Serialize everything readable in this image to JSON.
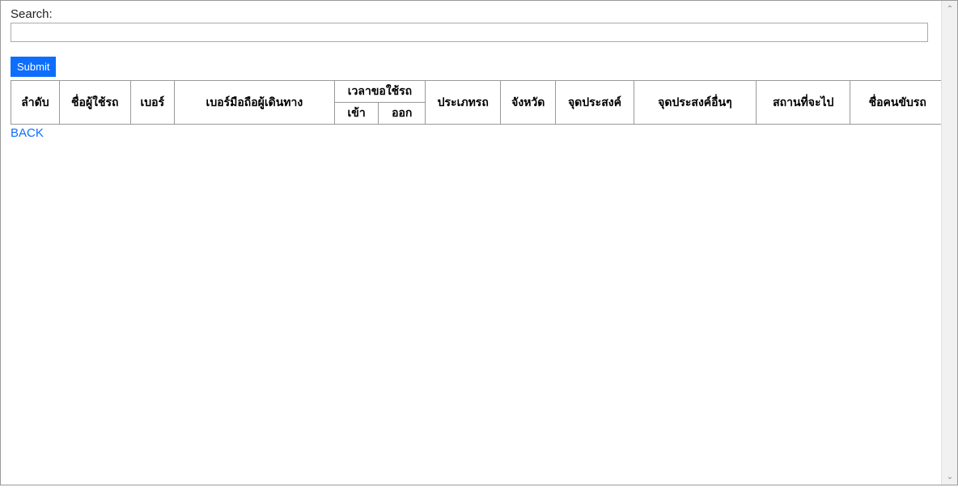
{
  "search": {
    "label": "Search:",
    "value": ""
  },
  "buttons": {
    "submit": "Submit"
  },
  "table": {
    "headers": {
      "seq": "ลำดับ",
      "user": "ชื่อผู้ใช้รถ",
      "number": "เบอร์",
      "traveler_phone": "เบอร์มือถือผู้เดินทาง",
      "request_time": "เวลาขอใช้รถ",
      "time_in": "เข้า",
      "time_out": "ออก",
      "vehicle_type": "ประเภทรถ",
      "province": "จังหวัด",
      "purpose": "จุดประสงค์",
      "other_purpose": "จุดประสงค์อื่นๆ",
      "destination": "สถานที่จะไป",
      "driver": "ชื่อคนขับรถ"
    }
  },
  "links": {
    "back": "BACK"
  }
}
